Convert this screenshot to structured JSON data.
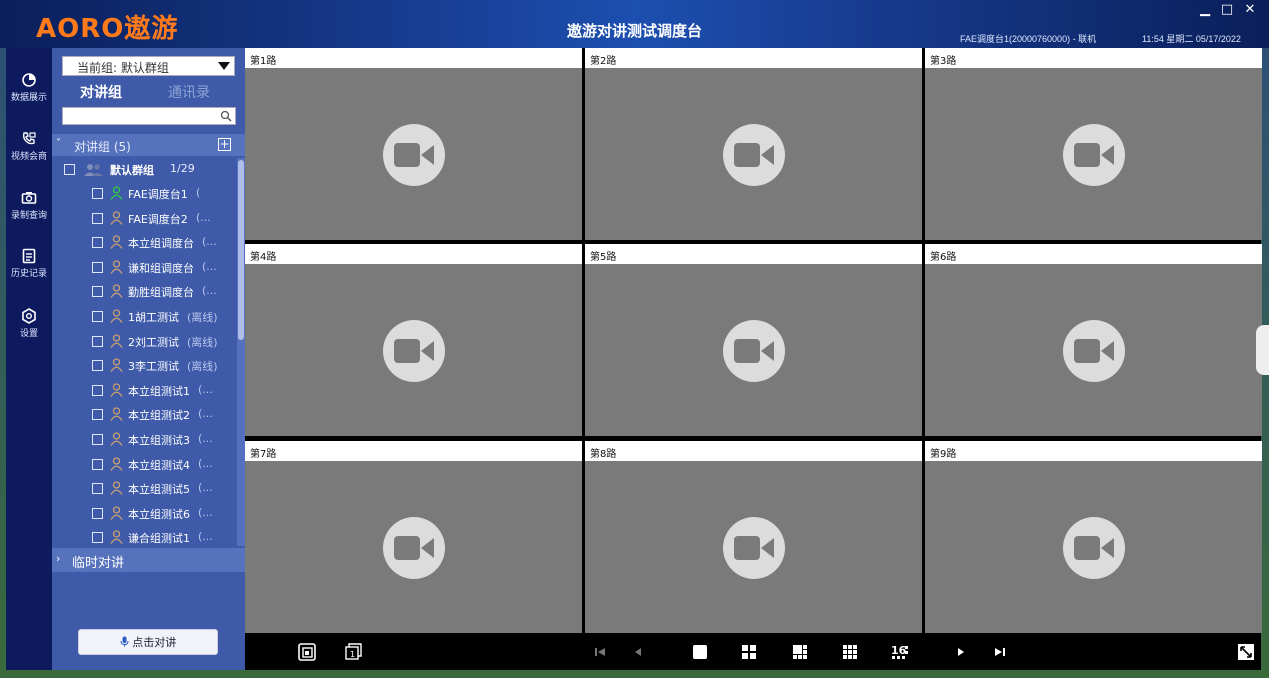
{
  "app": {
    "logo_text": "AORO遨游",
    "title": "遨游对讲测试调度台",
    "user_info": "FAE调度台1(20000760000) - 联机",
    "clock": "11:54 星期二 05/17/2022"
  },
  "window_controls": {
    "minimize": "▁",
    "maximize": "□",
    "close": "✕"
  },
  "nav": {
    "items": [
      {
        "label": "数据展示",
        "icon": "data-display-icon"
      },
      {
        "label": "视频会商",
        "icon": "video-meeting-icon"
      },
      {
        "label": "录制查询",
        "icon": "recording-query-icon"
      },
      {
        "label": "历史记录",
        "icon": "history-icon"
      },
      {
        "label": "设置",
        "icon": "settings-icon"
      }
    ]
  },
  "panel": {
    "current_group": "当前组: 默认群组",
    "tabs": [
      {
        "label": "对讲组",
        "active": true
      },
      {
        "label": "通讯录",
        "active": false
      }
    ],
    "search": {
      "placeholder": ""
    },
    "group_header": {
      "label": "对讲组 (5)"
    },
    "default_group": {
      "name": "默认群组",
      "count": "1/29"
    },
    "members": [
      {
        "name": "FAE调度台1",
        "status": "(",
        "online": true
      },
      {
        "name": "FAE调度台2",
        "status": "(...",
        "online": false
      },
      {
        "name": "本立组调度台",
        "status": "(...",
        "online": false
      },
      {
        "name": "谦和组调度台",
        "status": "(...",
        "online": false
      },
      {
        "name": "勤胜组调度台",
        "status": "(...",
        "online": false
      },
      {
        "name": "1胡工测试",
        "status": "(离线)",
        "online": false
      },
      {
        "name": "2刘工测试",
        "status": "(离线)",
        "online": false
      },
      {
        "name": "3李工测试",
        "status": "(离线)",
        "online": false
      },
      {
        "name": "本立组测试1",
        "status": "(...",
        "online": false
      },
      {
        "name": "本立组测试2",
        "status": "(...",
        "online": false
      },
      {
        "name": "本立组测试3",
        "status": "(...",
        "online": false
      },
      {
        "name": "本立组测试4",
        "status": "(...",
        "online": false
      },
      {
        "name": "本立组测试5",
        "status": "(...",
        "online": false
      },
      {
        "name": "本立组测试6",
        "status": "(...",
        "online": false
      },
      {
        "name": "谦合组测试1",
        "status": "(...",
        "online": false
      }
    ],
    "temp_talk": "临时对讲",
    "ptt_label": "点击对讲"
  },
  "video": {
    "channels": [
      "第1路",
      "第2路",
      "第3路",
      "第4路",
      "第5路",
      "第6路",
      "第7路",
      "第8路",
      "第9路"
    ]
  },
  "toolbar": {
    "buttons": [
      "snapshot-icon",
      "single-screen-icon",
      "first-page-icon",
      "prev-page-icon",
      "layout-1-icon",
      "layout-4-icon",
      "layout-6-icon",
      "layout-9-icon",
      "layout-16-icon",
      "next-page-icon",
      "last-page-icon",
      "fullscreen-icon"
    ],
    "layout_16_label": "16"
  },
  "colors": {
    "title_bar": "#163a8c",
    "nav_bg": "#0d1a5e",
    "panel_bg": "#3e5aa8",
    "logo": "#ff7a1a",
    "online": "#2ecc40",
    "video_bg": "#7a7a7a"
  }
}
